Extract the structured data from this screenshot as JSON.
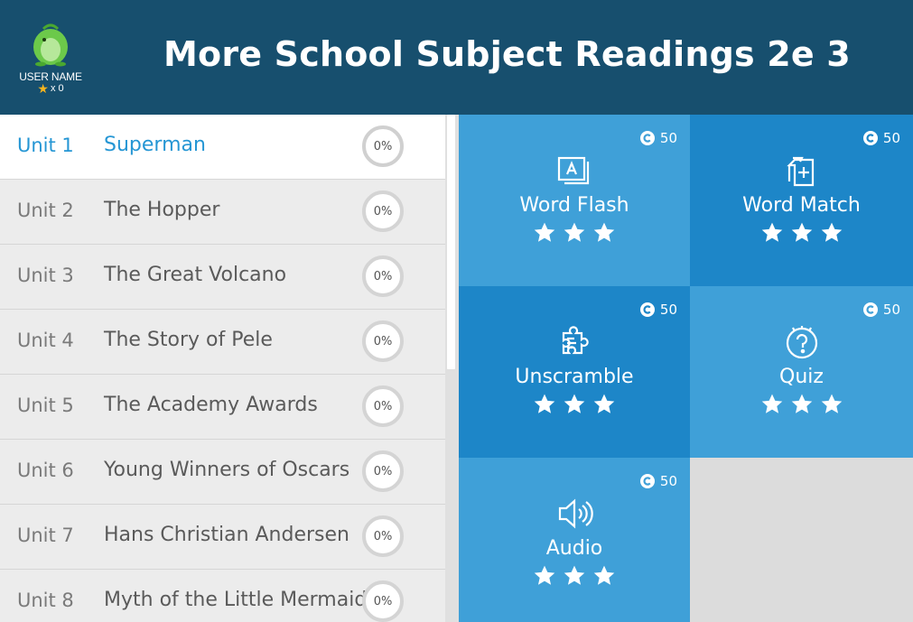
{
  "header": {
    "title": "More School Subject Readings 2e 3",
    "user_name": "USER NAME",
    "star_count": "x 0",
    "colors": {
      "header_bg": "#174f6e",
      "accent": "#2596d4",
      "star": "#f6b51e"
    }
  },
  "units": [
    {
      "num": "Unit 1",
      "title": "Superman",
      "progress": "0%",
      "active": true
    },
    {
      "num": "Unit 2",
      "title": "The Hopper",
      "progress": "0%"
    },
    {
      "num": "Unit 3",
      "title": "The Great Volcano",
      "progress": "0%"
    },
    {
      "num": "Unit 4",
      "title": "The Story of Pele",
      "progress": "0%"
    },
    {
      "num": "Unit 5",
      "title": "The Academy Awards",
      "progress": "0%"
    },
    {
      "num": "Unit 6",
      "title": "Young Winners of Oscars",
      "progress": "0%"
    },
    {
      "num": "Unit 7",
      "title": "Hans Christian Andersen",
      "progress": "0%"
    },
    {
      "num": "Unit 8",
      "title": "Myth of the Little Mermaid",
      "progress": "0%"
    }
  ],
  "activities": [
    {
      "label": "Word Flash",
      "coins": "50",
      "icon": "word-flash-icon",
      "stars": 3
    },
    {
      "label": "Word Match",
      "coins": "50",
      "icon": "word-match-icon",
      "stars": 3
    },
    {
      "label": "Unscramble",
      "coins": "50",
      "icon": "puzzle-icon",
      "stars": 3
    },
    {
      "label": "Quiz",
      "coins": "50",
      "icon": "question-icon",
      "stars": 3
    },
    {
      "label": "Audio",
      "coins": "50",
      "icon": "speaker-icon",
      "stars": 3
    }
  ]
}
